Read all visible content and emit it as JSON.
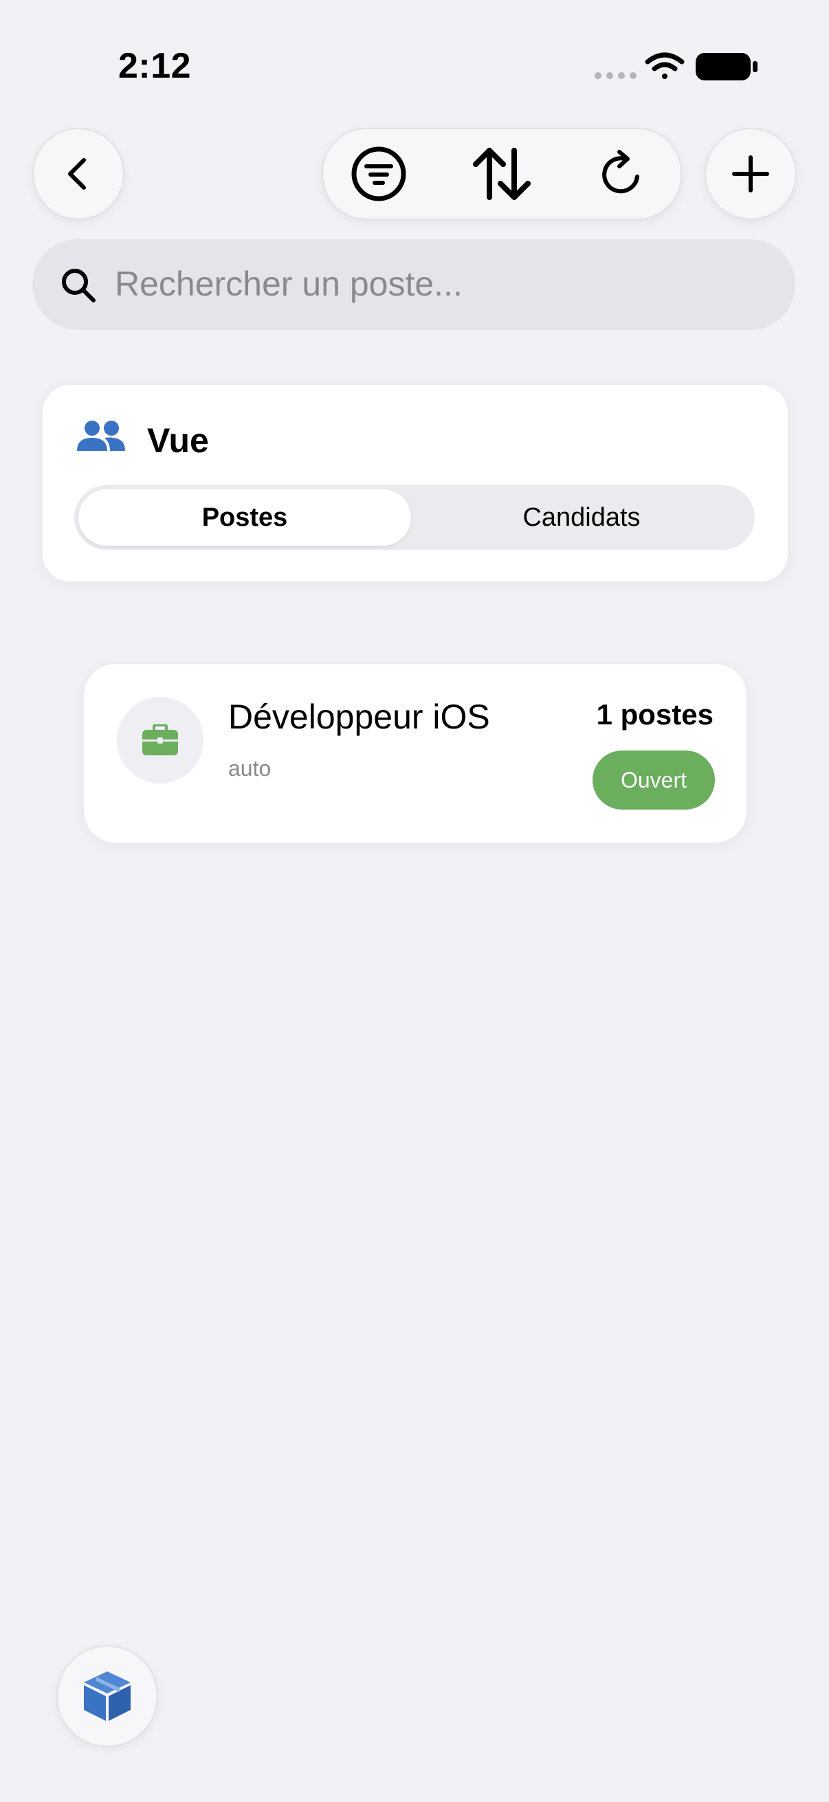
{
  "status_bar": {
    "time": "2:12",
    "icons": [
      "signal-dots-icon",
      "wifi-icon",
      "battery-icon"
    ]
  },
  "toolbar": {
    "back_icon": "chevron-left-icon",
    "filter_icon": "filter-icon",
    "sort_icon": "sort-arrows-icon",
    "refresh_icon": "refresh-icon",
    "add_icon": "plus-icon"
  },
  "search": {
    "placeholder": "Rechercher un poste..."
  },
  "view_card": {
    "title": "Vue",
    "icon": "people-icon",
    "segments": [
      {
        "label": "Postes",
        "selected": true
      },
      {
        "label": "Candidats",
        "selected": false
      }
    ]
  },
  "jobs": [
    {
      "title": "Développeur iOS",
      "subtitle": "auto",
      "count": "1 postes",
      "status": "Ouvert",
      "icon": "briefcase-icon"
    }
  ],
  "floating_button": {
    "icon": "cube-icon"
  },
  "colors": {
    "background": "#f1f1f6",
    "accent_blue": "#3a72c4",
    "status_green": "#6aae5e"
  }
}
